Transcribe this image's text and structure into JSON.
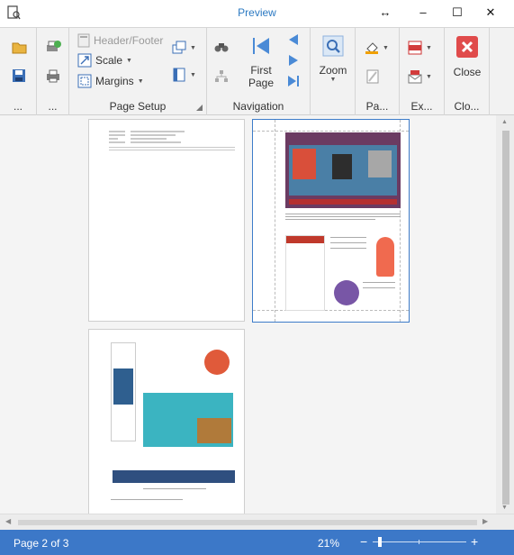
{
  "window": {
    "title": "Preview",
    "controls": [
      "↔",
      "–",
      "☐",
      "✕"
    ]
  },
  "ribbon": {
    "groups": [
      {
        "label": "..."
      },
      {
        "label": "..."
      },
      {
        "label": "Page Setup"
      },
      {
        "label": "Navigation"
      },
      {
        "label": ""
      },
      {
        "label": "Pa..."
      },
      {
        "label": "Ex..."
      },
      {
        "label": "Clo..."
      }
    ],
    "header_footer": "Header/Footer",
    "scale": "Scale",
    "margins": "Margins",
    "first_page_line1": "First",
    "first_page_line2": "Page",
    "zoom": "Zoom",
    "close": "Close"
  },
  "status": {
    "page": "Page 2 of 3",
    "zoom": "21%",
    "zoom_minus": "−",
    "zoom_plus": "+",
    "zoom_level_fraction": 0.08
  },
  "colors": {
    "accent": "#3c78c8",
    "title": "#2b79c2",
    "close_red": "#e04b4b"
  }
}
